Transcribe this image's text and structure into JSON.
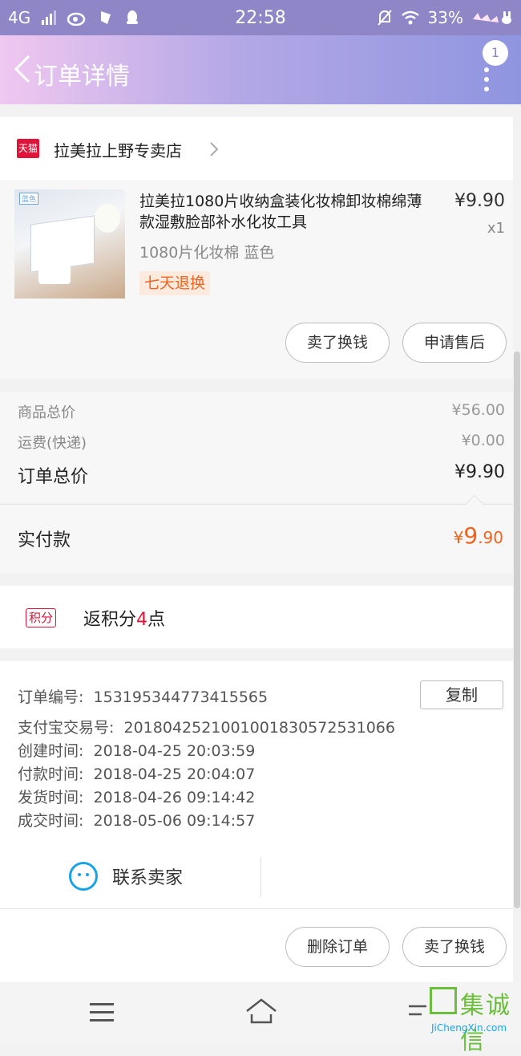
{
  "status_bar": {
    "network": "4G",
    "time": "22:58",
    "battery": "33%",
    "icons": [
      "signal-icon",
      "weibo-icon",
      "bug-icon",
      "qq-icon",
      "mute-icon",
      "wifi-icon",
      "bunny-icon"
    ]
  },
  "header": {
    "back_icon": "chevron-left-icon",
    "title": "订单详情",
    "message_count": "1",
    "more_icon": "more-vertical-icon"
  },
  "shop": {
    "logo_text": "天猫",
    "name": "拉美拉上野专卖店"
  },
  "product": {
    "thumb_tag": "蓝色",
    "title": "拉美拉1080片收纳盒装化妆棉卸妆棉绵薄款湿敷脸部补水化妆工具",
    "price": "¥9.90",
    "quantity": "x1",
    "spec": "1080片化妆棉 蓝色",
    "return_policy": "七天退换",
    "actions": [
      "卖了换钱",
      "申请售后"
    ]
  },
  "summary": {
    "rows": [
      {
        "label": "商品总价",
        "value": "¥56.00"
      },
      {
        "label": "运费(快递)",
        "value": "¥0.00"
      },
      {
        "label": "订单总价",
        "value": "¥9.90"
      }
    ]
  },
  "payment": {
    "label": "实付款",
    "currency": "¥",
    "integer": "9",
    "decimal": ".90"
  },
  "points": {
    "tag": "积分",
    "prefix": "返积分",
    "count": "4",
    "suffix": "点"
  },
  "order_info": {
    "copy_label": "复制",
    "lines": [
      {
        "label": "订单编号:",
        "value": "153195344773415565"
      },
      {
        "label": "支付宝交易号:",
        "value": "2018042521001001830572531066"
      },
      {
        "label": "创建时间:",
        "value": "2018-04-25 20:03:59"
      },
      {
        "label": "付款时间:",
        "value": "2018-04-25 20:04:07"
      },
      {
        "label": "发货时间:",
        "value": "2018-04-26 09:14:42"
      },
      {
        "label": "成交时间:",
        "value": "2018-05-06 09:14:57"
      }
    ],
    "contact_label": "联系卖家"
  },
  "footer": {
    "actions": [
      "删除订单",
      "卖了换钱"
    ]
  },
  "watermark": {
    "text_zh": "集诚信",
    "text_en": "JiChengXin.com"
  },
  "colors": {
    "accent_orange": "#f0641e",
    "tmall_red": "#e0133a",
    "header_purple": "#8f86c8",
    "contact_blue": "#1aa3e8"
  }
}
